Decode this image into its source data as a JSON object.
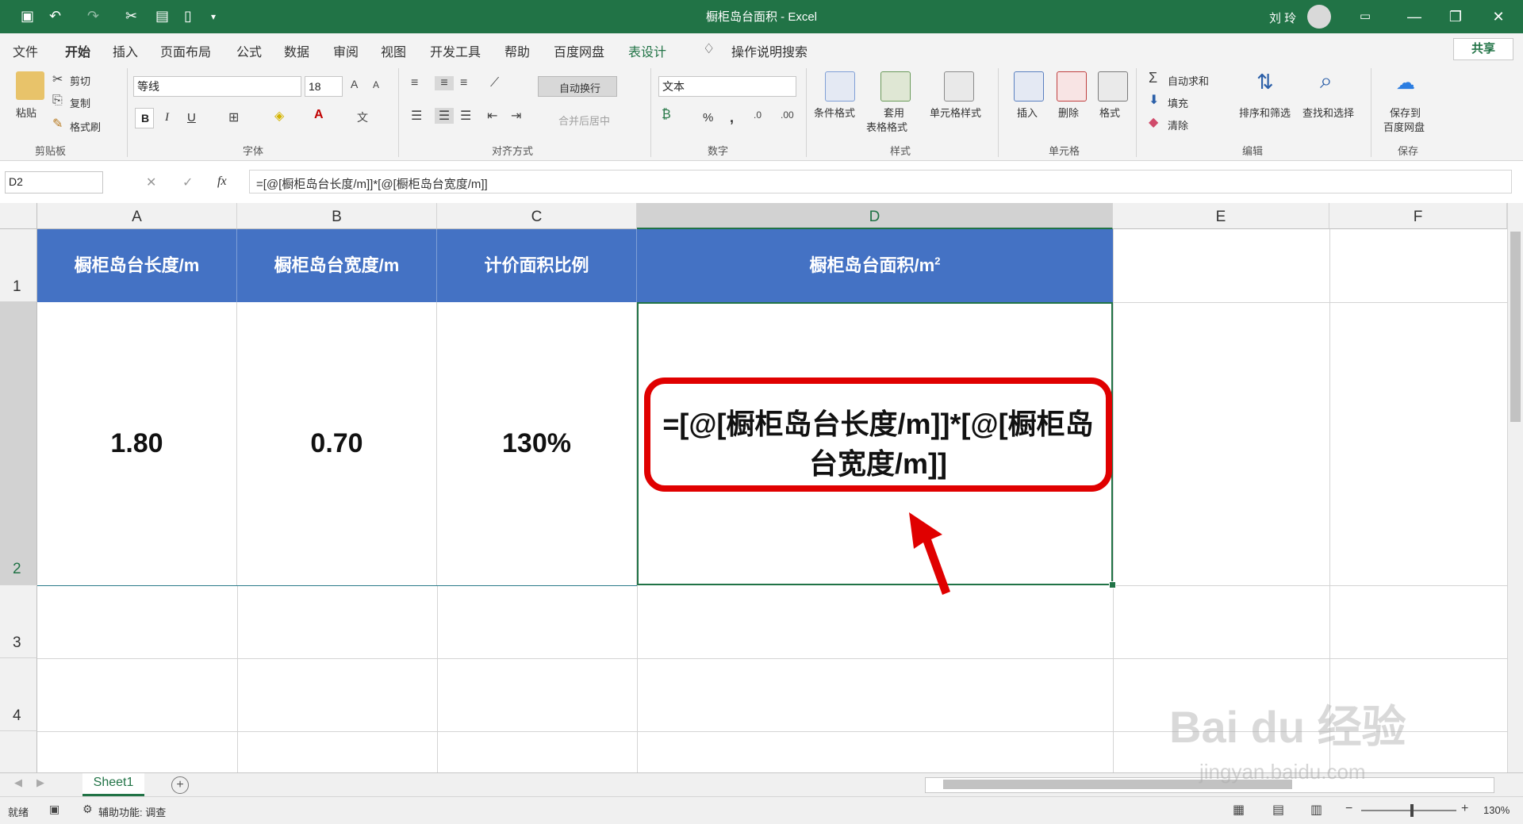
{
  "window": {
    "title": "橱柜岛台面积  -  Excel",
    "user": "刘 玲"
  },
  "menu": {
    "tabs": [
      "文件",
      "开始",
      "插入",
      "页面布局",
      "公式",
      "数据",
      "审阅",
      "视图",
      "开发工具",
      "帮助",
      "百度网盘",
      "表设计"
    ],
    "tell_me": "操作说明搜索",
    "share": "共享"
  },
  "ribbon": {
    "clipboard": {
      "paste": "粘贴",
      "cut": "剪切",
      "copy": "复制",
      "format_painter": "格式刷",
      "label": "剪贴板"
    },
    "font": {
      "name": "等线",
      "size": "18",
      "bold": "B",
      "italic": "I",
      "underline": "U",
      "label": "字体"
    },
    "alignment": {
      "wrap": "自动换行",
      "merge": "合并后居中",
      "label": "对齐方式"
    },
    "number": {
      "format": "文本",
      "percent": "%",
      "comma": ",",
      "label": "数字"
    },
    "styles": {
      "conditional": "条件格式",
      "table_line1": "套用",
      "table_line2": "表格格式",
      "cell_styles": "单元格样式",
      "label": "样式"
    },
    "cells": {
      "insert": "插入",
      "delete": "删除",
      "format": "格式",
      "label": "单元格"
    },
    "editing": {
      "autosum": "自动求和",
      "fill": "填充",
      "clear": "清除",
      "sort": "排序和筛选",
      "find": "查找和选择",
      "label": "编辑"
    },
    "save": {
      "line1": "保存到",
      "line2": "百度网盘",
      "label": "保存"
    }
  },
  "formula_bar": {
    "name_box": "D2",
    "fx": "fx",
    "formula": "=[@[橱柜岛台长度/m]]*[@[橱柜岛台宽度/m]]"
  },
  "sheet": {
    "columns": [
      "A",
      "B",
      "C",
      "D",
      "E",
      "F"
    ],
    "rows": [
      "1",
      "2",
      "3",
      "4"
    ],
    "headers": [
      "橱柜岛台长度/m",
      "橱柜岛台宽度/m",
      "计价面积比例",
      "橱柜岛台面积/m"
    ],
    "header_d_sup": "2",
    "values": [
      "1.80",
      "0.70",
      "130%"
    ],
    "d2_line1": "=[@[橱柜岛台长度/m]]*[@[橱柜岛台宽度/m]]",
    "header_color": "#4472c4",
    "highlight_color": "#e00000"
  },
  "tabs_bar": {
    "sheet_name": "Sheet1",
    "add": "+"
  },
  "status": {
    "ready": "就绪",
    "accessibility": "辅助功能: 调查",
    "zoom": "130%"
  },
  "watermark": {
    "line1": "Bai du 经验",
    "line2": "jingyan.baidu.com"
  }
}
